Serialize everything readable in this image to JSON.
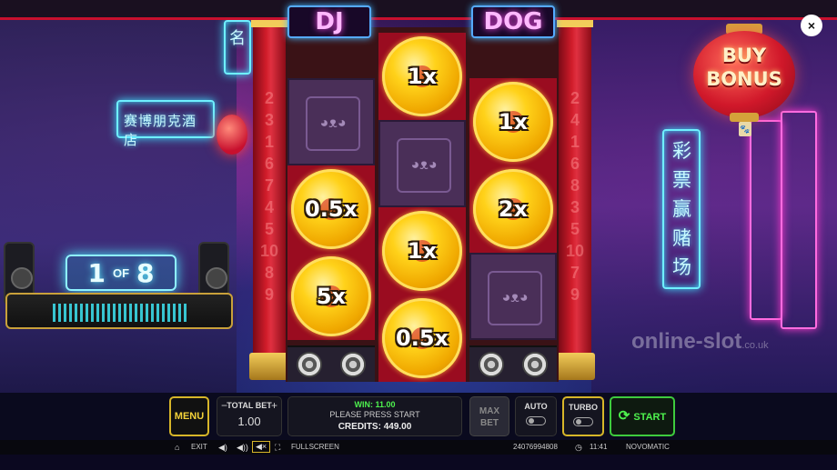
{
  "background": {
    "signs": [
      "赛博朋克酒店",
      "彩票赢赌场",
      "名"
    ]
  },
  "free_spins": {
    "current": "1",
    "of": "OF",
    "total": "8"
  },
  "buy_bonus": {
    "label_line1": "BUY",
    "label_line2": "BONUS"
  },
  "close_button": {
    "icon": "close-icon",
    "label": "×"
  },
  "reel_titles": {
    "left": "DJ",
    "right": "DOG"
  },
  "pillar_numbers": {
    "left": [
      "2",
      "3",
      "1",
      "6",
      "7",
      "4",
      "5",
      "10",
      "8",
      "9"
    ],
    "right": [
      "2",
      "4",
      "1",
      "6",
      "8",
      "3",
      "5",
      "10",
      "7",
      "9"
    ]
  },
  "reels": [
    [
      {
        "type": "empty",
        "icon": "dog-icon"
      },
      {
        "type": "coin",
        "value": "0.5x"
      },
      {
        "type": "coin",
        "value": "5x"
      }
    ],
    [
      {
        "type": "coin",
        "value": "1x"
      },
      {
        "type": "empty",
        "icon": "dog-icon"
      },
      {
        "type": "coin",
        "value": "1x"
      },
      {
        "type": "coin",
        "value": "0.5x"
      }
    ],
    [
      {
        "type": "coin",
        "value": "1x"
      },
      {
        "type": "coin",
        "value": "2x"
      },
      {
        "type": "empty",
        "icon": "dog-icon"
      }
    ]
  ],
  "watermark": {
    "text": "online-slot",
    "suffix": ".co.uk"
  },
  "controls": {
    "menu_label": "MENU",
    "total_bet_label": "TOTAL BET",
    "total_bet_value": "1.00",
    "minus": "−",
    "plus": "+",
    "win_text": "WIN: 11.00",
    "message": "PLEASE PRESS START",
    "credits_text": "CREDITS: 449.00",
    "max_bet_line1": "MAX",
    "max_bet_line2": "BET",
    "auto_label": "AUTO",
    "turbo_label": "TURBO",
    "start_label": "START"
  },
  "statusbar": {
    "exit_label": "EXIT",
    "fullscreen_label": "FULLSCREEN",
    "session_id": "24076994808",
    "time": "11:41",
    "brand": "NOVOMATIC"
  },
  "colors": {
    "accent_gold": "#d7b629",
    "start_green": "#4ef24e",
    "pillar_red": "#d01c2a",
    "neon_cyan": "#6ff0ff",
    "neon_pink": "#ff4cf0"
  }
}
